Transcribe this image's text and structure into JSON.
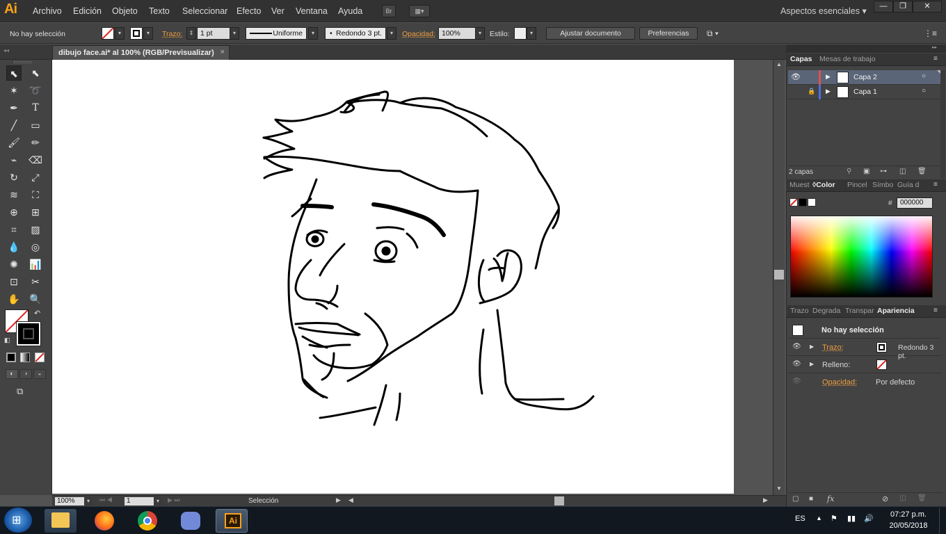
{
  "menubar": {
    "logo": "Ai",
    "items": [
      "Archivo",
      "Edición",
      "Objeto",
      "Texto",
      "Seleccionar",
      "Efecto",
      "Ver",
      "Ventana",
      "Ayuda"
    ],
    "bridge_label": "Br",
    "workspace": "Aspectos esenciales",
    "window_buttons": {
      "minimize": "—",
      "restore": "❐",
      "close": "✕"
    }
  },
  "control": {
    "selection_status": "No hay selección",
    "stroke_label": "Trazo:",
    "stroke_weight": "1 pt",
    "profile": "Uniforme",
    "brush": "Redondo 3 pt.",
    "opacity_label": "Opacidad:",
    "opacity": "100%",
    "style_label": "Estilo:",
    "document_setup": "Ajustar documento",
    "preferences": "Preferencias"
  },
  "document": {
    "tab_title": "dibujo face.ai* al 100% (RGB/Previsualizar)",
    "close_glyph": "×"
  },
  "status": {
    "zoom": "100%",
    "artboard": "1",
    "tool": "Selección"
  },
  "layers_panel": {
    "tabs": [
      "Capas",
      "Mesas de trabajo"
    ],
    "layers": [
      {
        "name": "Capa 2",
        "color": "#e05050",
        "selected": true
      },
      {
        "name": "Capa 1",
        "color": "#4a6ee0",
        "selected": false
      }
    ],
    "count": "2 capas"
  },
  "color_panel": {
    "tabs": [
      "Muest",
      "Color",
      "Pincel",
      "Símbo",
      "Guía d"
    ],
    "hash": "#",
    "hex": "000000"
  },
  "appearance_panel": {
    "tabs": [
      "Trazo",
      "Degrada",
      "Transpar",
      "Apariencia"
    ],
    "header": "No hay selección",
    "stroke_label": "Trazo:",
    "stroke_value": "Redondo 3 pt.",
    "fill_label": "Relleno:",
    "opacity_label": "Opacidad:",
    "opacity_value": "Por defecto"
  },
  "taskbar": {
    "language": "ES",
    "time": "07:27 p.m.",
    "date": "20/05/2018",
    "illustrator_label": "Ai"
  }
}
